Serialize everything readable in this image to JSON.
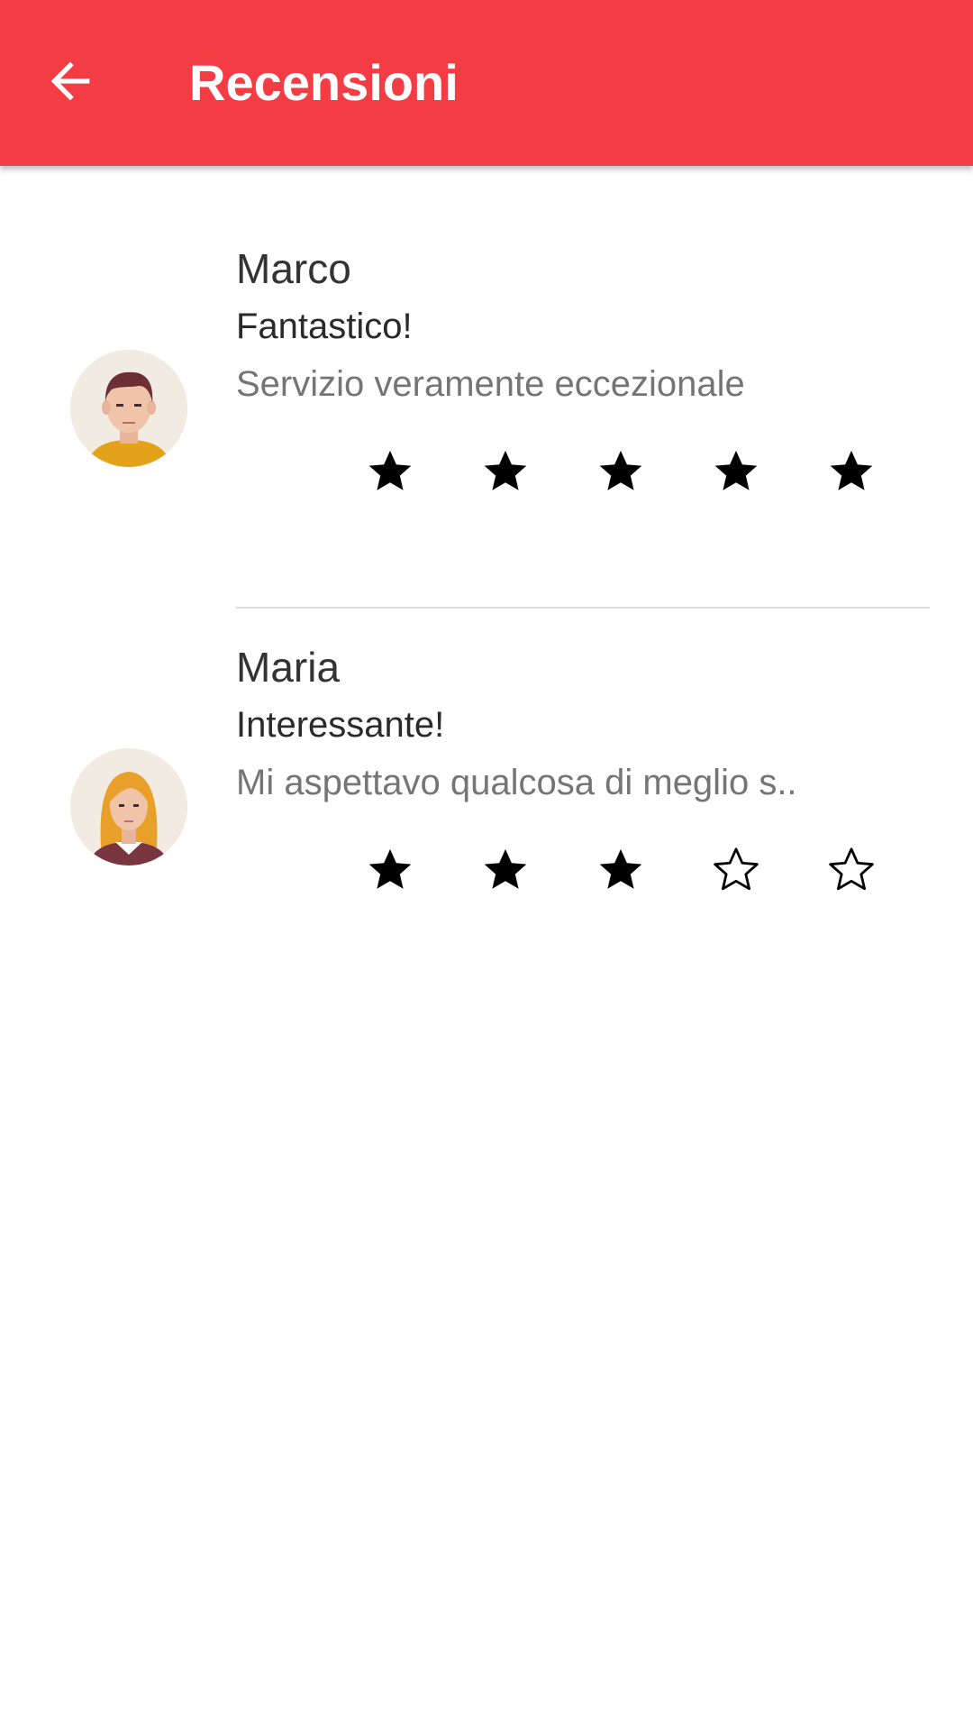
{
  "app_bar": {
    "title": "Recensioni",
    "background_color": "#f43c44",
    "back_icon": "arrow-back-icon"
  },
  "reviews": [
    {
      "name": "Marco",
      "title": "Fantastico!",
      "text": "Servizio veramente eccezionale",
      "rating": 5,
      "max_rating": 5,
      "avatar": "male-avatar-icon"
    },
    {
      "name": "Maria",
      "title": "Interessante!",
      "text": "Mi aspettavo qualcosa di meglio s..",
      "rating": 3,
      "max_rating": 5,
      "avatar": "female-avatar-icon"
    }
  ]
}
